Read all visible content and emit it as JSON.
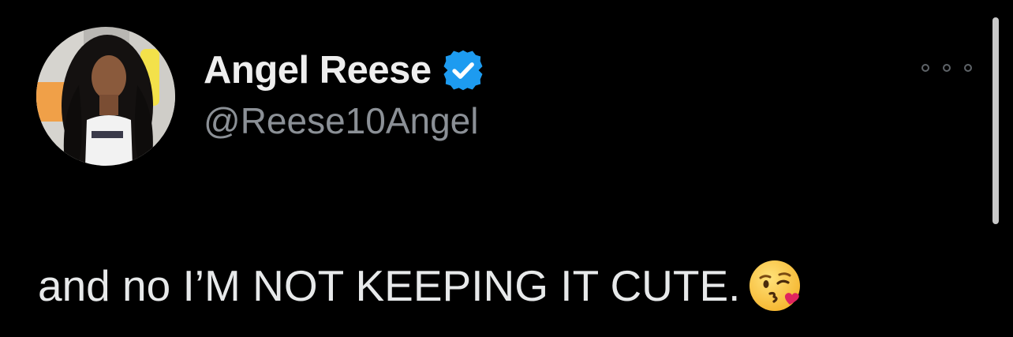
{
  "tweet": {
    "author": {
      "display_name": "Angel Reese",
      "handle": "@Reese10Angel",
      "verified": true,
      "avatar_icon": "profile-photo"
    },
    "text": "and no I’M NOT KEEPING IT CUTE.",
    "emoji": "face-blowing-a-kiss",
    "more_menu_icon": "ellipsis-icon"
  },
  "colors": {
    "background": "#000000",
    "text_primary": "#e7e9ea",
    "text_secondary": "#8b9096",
    "verified_badge": "#1d9bf0"
  }
}
